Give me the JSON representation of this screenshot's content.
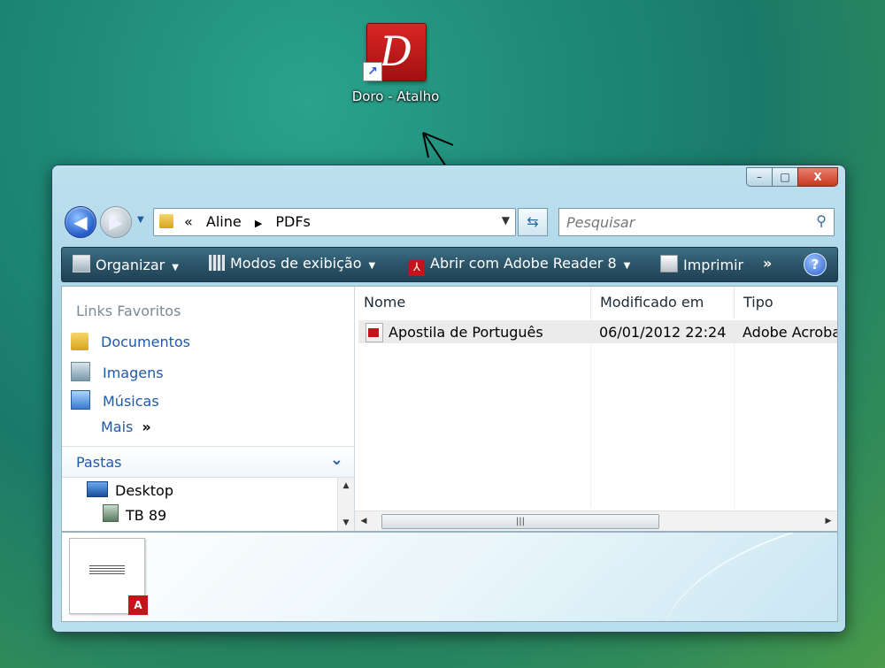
{
  "desktop": {
    "shortcut": {
      "label": "Doro - Atalho",
      "icon": "doro-app-icon",
      "tile_color": "#c81a1a",
      "glyph": "D"
    }
  },
  "window": {
    "caption_buttons": {
      "minimize": "–",
      "maximize": "□",
      "close": "X"
    },
    "address": {
      "recent": "«",
      "path": [
        "Aline",
        "PDFs"
      ],
      "separator": "▶"
    },
    "search": {
      "placeholder": "Pesquisar"
    },
    "toolbar": {
      "organize": "Organizar",
      "views": "Modos de exibição",
      "open_with": "Abrir com Adobe Reader 8",
      "print": "Imprimir",
      "more": "»",
      "help": "?"
    },
    "navigation": {
      "favorites_header": "Links Favoritos",
      "links": [
        "Documentos",
        "Imagens",
        "Músicas"
      ],
      "more": "Mais",
      "more_glyph": "»",
      "folders_header": "Pastas",
      "tree": [
        "Desktop",
        "TB 89"
      ]
    },
    "files": {
      "columns": [
        "Nome",
        "Modificado em",
        "Tipo"
      ],
      "rows": [
        {
          "name": "Apostila de Português",
          "modified": "06/01/2012 22:24",
          "type": "Adobe Acrobat"
        }
      ]
    },
    "details": {
      "thumbnail_badge": "A"
    }
  },
  "colors": {
    "toolbar": "#2c5468",
    "link": "#1e5aa8",
    "pdf_red": "#c3141a"
  }
}
